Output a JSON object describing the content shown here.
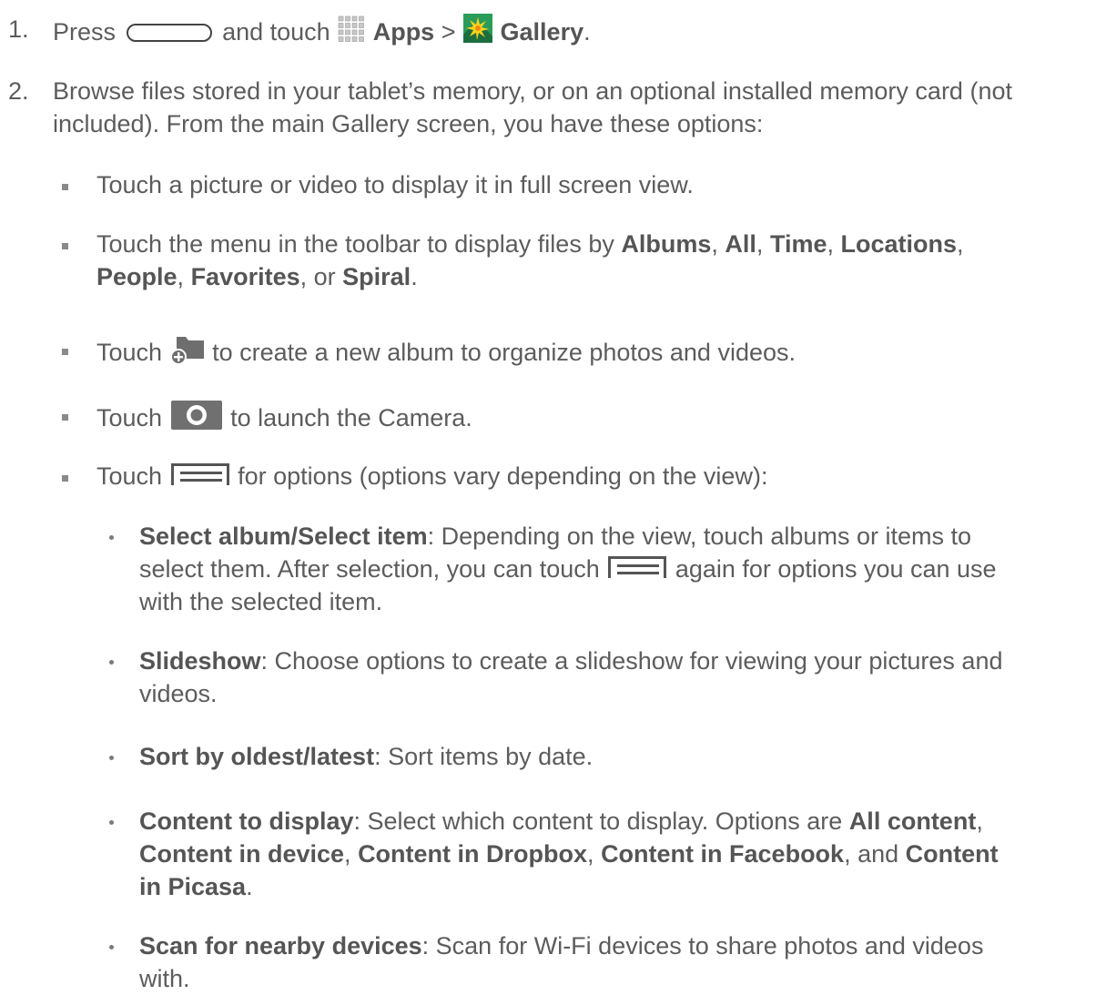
{
  "step1": {
    "num": "1.",
    "press": "Press",
    "and_touch": "and touch",
    "apps": "Apps",
    "gt": ">",
    "gallery": "Gallery",
    "period": "."
  },
  "step2": {
    "num": "2.",
    "line1": "Browse files stored in your tablet’s memory, or on an optional installed memory card (not",
    "line2": "included). From the main Gallery screen, you have these options:"
  },
  "b1": {
    "text": "Touch a picture or video to display it in full screen view."
  },
  "b2": {
    "t1": "Touch the menu in the toolbar to display files by",
    "albums": "Albums",
    "c1": ",",
    "all": "All",
    "c2": ",",
    "time": "Time",
    "c3": ",",
    "locations": "Locations",
    "c4": ",",
    "people": "People",
    "c5": ",",
    "favorites": "Favorites",
    "c6": ", or",
    "spiral": "Spiral",
    "c7": "."
  },
  "b3": {
    "touch": "Touch",
    "rest": "to create a new album to organize photos and videos."
  },
  "b4": {
    "touch": "Touch",
    "rest": "to launch the Camera."
  },
  "b5": {
    "touch": "Touch",
    "rest": "for options (options vary depending on the view):"
  },
  "s1": {
    "term": "Select album/Select item",
    "l1": ": Depending on the view, touch albums or items to",
    "l2a": "select them. After selection, you can touch",
    "l2b": "again for options you can use",
    "l3": "with the selected item."
  },
  "s2": {
    "term": "Slideshow",
    "l1": ": Choose options to create a slideshow for viewing your pictures and",
    "l2": "videos."
  },
  "s3": {
    "term": "Sort by oldest/latest",
    "l1": ": Sort items by date."
  },
  "s4": {
    "term": "Content to display",
    "l1": ": Select which content to display. Options are",
    "all_content": "All content",
    "c1": ",",
    "in_device": "Content in device",
    "c2": ",",
    "in_dropbox": "Content in Dropbox",
    "c3": ",",
    "in_facebook": "Content in Facebook",
    "c4": ", and",
    "content": "Content",
    "in_picasa": "in Picasa",
    "c5": "."
  },
  "s5": {
    "term": "Scan for nearby devices",
    "l1": ": Scan for Wi-Fi devices to share photos and videos",
    "l2": "with."
  },
  "icons": {
    "home": "home-button-icon",
    "apps": "apps-grid-icon",
    "gallery": "gallery-icon",
    "new_album": "new-album-icon",
    "camera": "camera-icon",
    "menu": "menu-icon"
  }
}
